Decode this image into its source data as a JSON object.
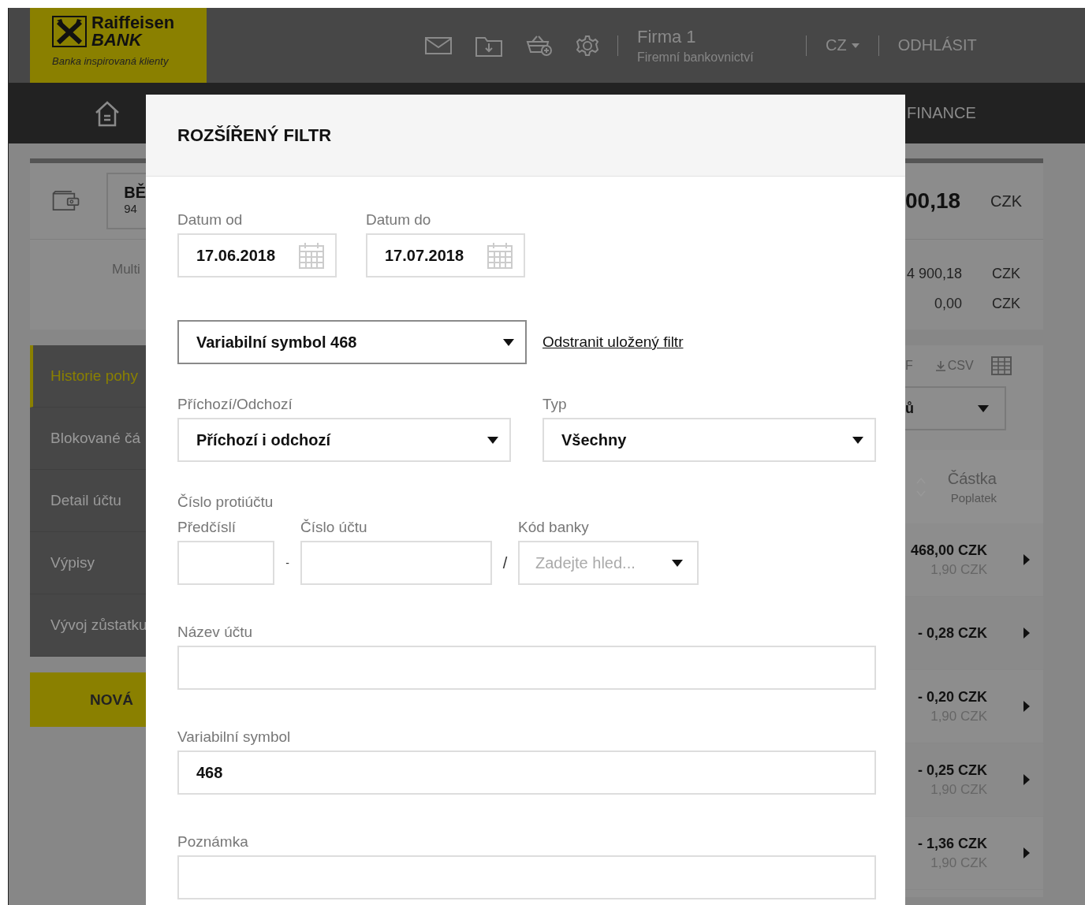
{
  "header": {
    "logo": {
      "name": "Raiffeisen",
      "name2": "BANK",
      "slogan": "Banka inspirovaná klienty"
    },
    "company": "Firma 1",
    "company_sub": "Firemní bankovnictví",
    "language": "CZ",
    "logout": "ODHLÁSIT"
  },
  "nav": {
    "item": "FINANCE"
  },
  "account_card": {
    "name": "BĚ",
    "number": "94",
    "label": "Multi",
    "balance": "00,18",
    "currency": "CZK",
    "rows": [
      {
        "amount": "4 900,18",
        "currency": "CZK"
      },
      {
        "amount": "0,00",
        "currency": "CZK"
      }
    ]
  },
  "sidebar": {
    "items": [
      {
        "label": "Historie pohy",
        "selected": true
      },
      {
        "label": "Blokované čá",
        "selected": false
      },
      {
        "label": "Detail účtu",
        "selected": false
      },
      {
        "label": "Výpisy",
        "selected": false
      },
      {
        "label": "Vývoj zůstatku",
        "selected": false
      }
    ],
    "new_button": "NOVÁ"
  },
  "transactions": {
    "export": [
      "F",
      "CSV"
    ],
    "filter_value": "ů",
    "column": "Částka",
    "column_sub": "Poplatek",
    "rows": [
      {
        "amount": "468,00 CZK",
        "fee": "1,90 CZK"
      },
      {
        "amount": "- 0,28 CZK"
      },
      {
        "amount": "- 0,20 CZK",
        "fee": "1,90 CZK"
      },
      {
        "amount": "- 0,25 CZK",
        "fee": "1,90 CZK"
      },
      {
        "amount": "- 1,36 CZK",
        "fee": "1,90 CZK"
      }
    ]
  },
  "modal": {
    "title": "ROZŠÍŘENÝ FILTR",
    "date_from": {
      "label": "Datum od",
      "value": "17.06.2018"
    },
    "date_to": {
      "label": "Datum do",
      "value": "17.07.2018"
    },
    "saved_filter": {
      "value": "Variabilní symbol 468",
      "remove_link": "Odstranit uložený filtr"
    },
    "direction": {
      "label": "Příchozí/Odchozí",
      "value": "Příchozí i odchozí"
    },
    "type": {
      "label": "Typ",
      "value": "Všechny"
    },
    "counter_account": {
      "label": "Číslo protiúčtu",
      "prefix_label": "Předčíslí",
      "separator1": "-",
      "number_label": "Číslo účtu",
      "separator2": "/",
      "bank_label": "Kód banky",
      "bank_placeholder": "Zadejte hled..."
    },
    "account_name": {
      "label": "Název účtu"
    },
    "variable_symbol": {
      "label": "Variabilní symbol",
      "value": "468"
    },
    "note": {
      "label": "Poznámka"
    }
  }
}
